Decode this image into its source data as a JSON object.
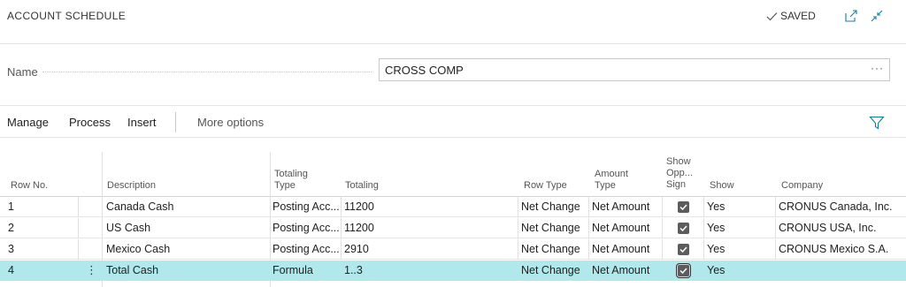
{
  "header": {
    "title": "ACCOUNT SCHEDULE",
    "saved_label": "SAVED"
  },
  "form": {
    "name_label": "Name",
    "name_value": "CROSS COMP",
    "name_ellipsis": "···"
  },
  "actions": {
    "manage": "Manage",
    "process": "Process",
    "insert": "Insert",
    "more_options": "More options"
  },
  "columns": {
    "row_no": "Row No.",
    "description": "Description",
    "totaling_type_1": "Totaling",
    "totaling_type_2": "Type",
    "totaling": "Totaling",
    "row_type": "Row Type",
    "amount_type_1": "Amount",
    "amount_type_2": "Type",
    "show_opp_1": "Show",
    "show_opp_2": "Opp...",
    "show_opp_3": "Sign",
    "show": "Show",
    "company": "Company"
  },
  "rows": [
    {
      "row_no": "1",
      "description": "Canada Cash",
      "totaling_type": "Posting Acc...",
      "totaling": "11200",
      "row_type": "Net Change",
      "amount_type": "Net Amount",
      "show_opp_sign": true,
      "show": "Yes",
      "company": "CRONUS Canada, Inc."
    },
    {
      "row_no": "2",
      "description": "US Cash",
      "totaling_type": "Posting Acc...",
      "totaling": "11200",
      "row_type": "Net Change",
      "amount_type": "Net Amount",
      "show_opp_sign": true,
      "show": "Yes",
      "company": "CRONUS USA, Inc."
    },
    {
      "row_no": "3",
      "description": "Mexico Cash",
      "totaling_type": "Posting Acc...",
      "totaling": "2910",
      "row_type": "Net Change",
      "amount_type": "Net Amount",
      "show_opp_sign": true,
      "show": "Yes",
      "company": "CRONUS Mexico S.A."
    },
    {
      "row_no": "4",
      "description": "Total Cash",
      "totaling_type": "Formula",
      "totaling": "1..3",
      "row_type": "Net Change",
      "amount_type": "Net Amount",
      "show_opp_sign": true,
      "show": "Yes",
      "company": "",
      "selected": true
    }
  ],
  "colors": {
    "selected_row": "#b0e8ec",
    "accent": "#0f7fa0"
  },
  "icons": {
    "saved": "checkmark-icon",
    "open_new": "open-in-new-window-icon",
    "collapse": "collapse-icon",
    "filter": "filter-icon",
    "row_menu": "vertical-ellipsis-icon"
  }
}
